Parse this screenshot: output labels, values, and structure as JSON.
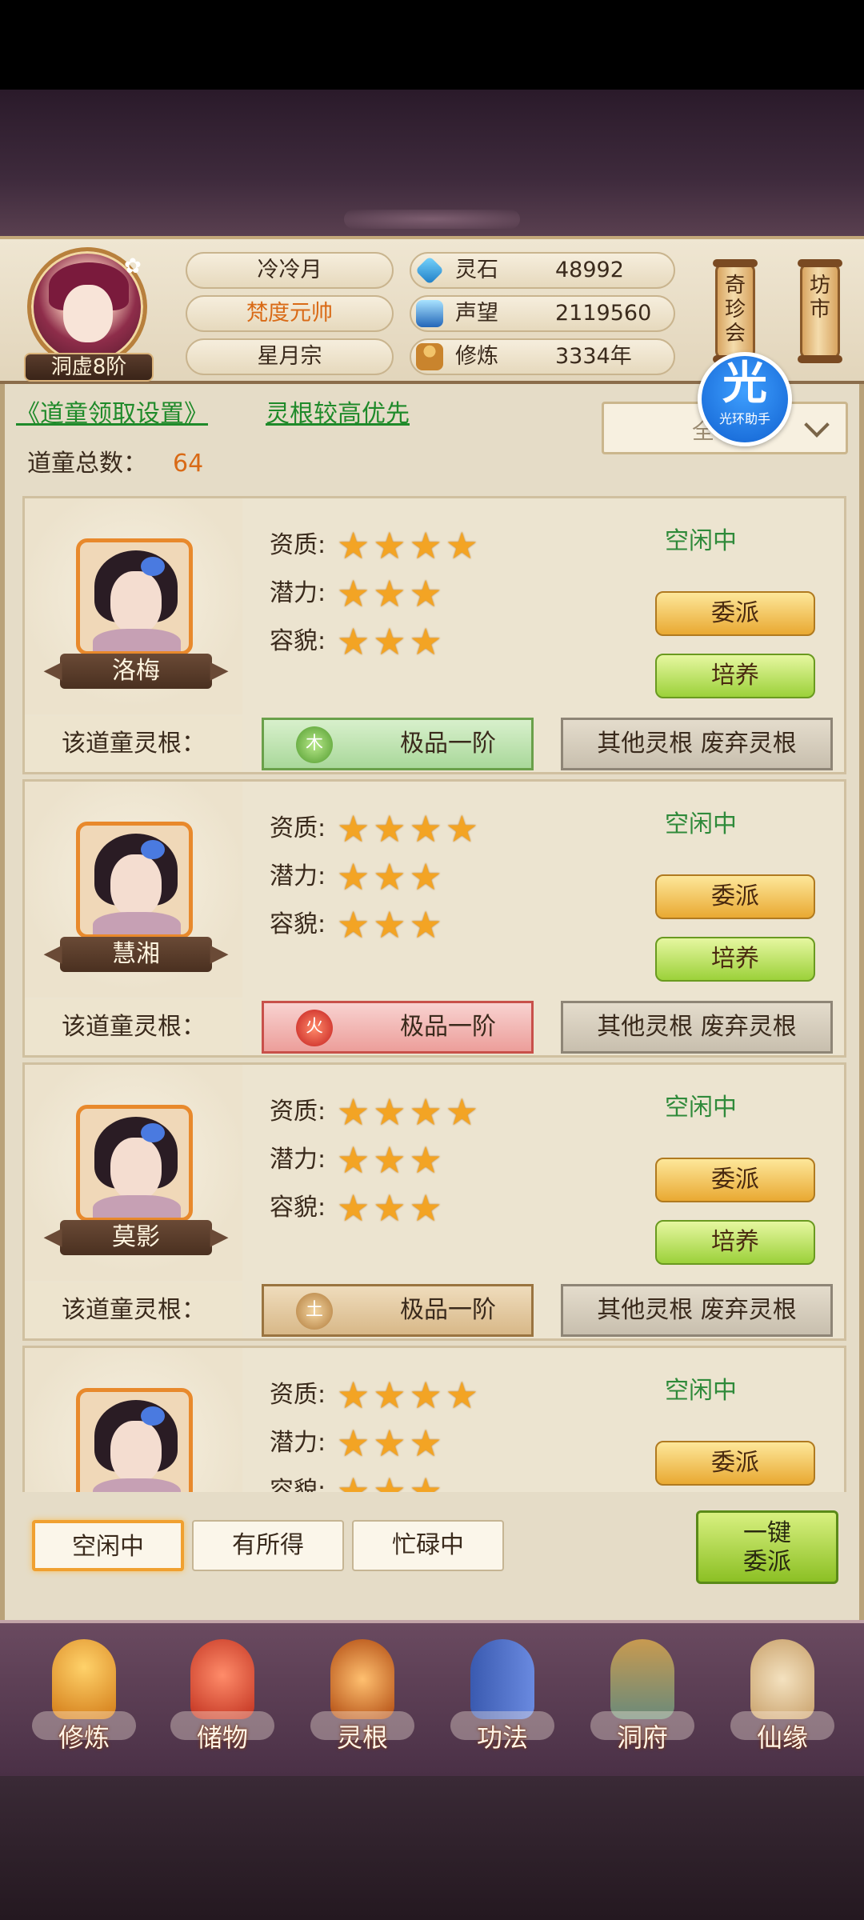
{
  "player": {
    "name": "冷冷月",
    "title": "梵度元帅",
    "sect": "星月宗",
    "realm": "洞虚8阶"
  },
  "resources": [
    {
      "icon": "spirit-stone-icon",
      "label": "灵石",
      "value": "48992"
    },
    {
      "icon": "reputation-crystal-icon",
      "label": "声望",
      "value": "2119560"
    },
    {
      "icon": "meditation-icon",
      "label": "修炼",
      "value": "3334年"
    }
  ],
  "side_buttons": {
    "treasure": [
      "奇",
      "珍",
      "会"
    ],
    "market": [
      "坊",
      "市"
    ]
  },
  "settings": {
    "link_label": "《道童领取设置》",
    "priority_label": "灵根较高优先",
    "dropdown_value": "全",
    "helper_big": "光",
    "helper_small": "光环助手"
  },
  "total": {
    "label": "道童总数：",
    "value": "64"
  },
  "labels": {
    "aptitude": "资质:",
    "potential": "潜力:",
    "appearance": "容貌:",
    "root_label": "该道童灵根：",
    "dispatch": "委派",
    "train": "培养",
    "other_root": "其他灵根 废弃灵根",
    "arrow_left": "◀",
    "arrow_right": "▶",
    "star": "★"
  },
  "disciples": [
    {
      "name": "洛梅",
      "aptitude": 4,
      "potential": 3,
      "appearance": 3,
      "status": "空闲中",
      "root_element": "木",
      "root_grade": "极品一阶",
      "root_type": "wood"
    },
    {
      "name": "慧湘",
      "aptitude": 4,
      "potential": 3,
      "appearance": 3,
      "status": "空闲中",
      "root_element": "火",
      "root_grade": "极品一阶",
      "root_type": "fire"
    },
    {
      "name": "莫影",
      "aptitude": 4,
      "potential": 3,
      "appearance": 3,
      "status": "空闲中",
      "root_element": "土",
      "root_grade": "极品一阶",
      "root_type": "earth"
    },
    {
      "name": "",
      "aptitude": 4,
      "potential": 3,
      "appearance": 3,
      "status": "空闲中",
      "root_element": "",
      "root_grade": "",
      "root_type": "earth"
    }
  ],
  "filters": {
    "tabs": [
      "空闲中",
      "有所得",
      "忙碌中"
    ],
    "active": 0,
    "one_click": [
      "一键",
      "委派"
    ]
  },
  "nav": [
    {
      "label": "修炼",
      "icon": "cultivate-icon"
    },
    {
      "label": "储物",
      "icon": "storage-bag-icon"
    },
    {
      "label": "灵根",
      "icon": "spirit-root-icon"
    },
    {
      "label": "功法",
      "icon": "skill-book-icon"
    },
    {
      "label": "洞府",
      "icon": "cave-dwelling-icon"
    },
    {
      "label": "仙缘",
      "icon": "gourd-icon"
    }
  ]
}
